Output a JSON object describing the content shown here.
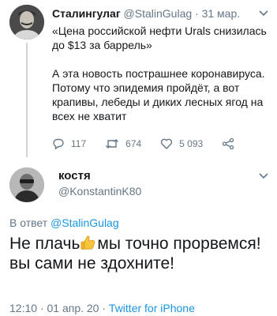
{
  "tweet1": {
    "author_name": "Сталингулаг",
    "author_handle": "@StalinGulag",
    "separator": "·",
    "date": "31 мар.",
    "paragraph1": "«Цена российской нефти Urals снизилась до $13 за баррель»",
    "paragraph2": "А эта новость пострашнее коронавируса. Потому что эпидемия пройдёт, а вот крапивы, лебеды и диких лесных ягод на всех не хватит",
    "replies": "117",
    "retweets": "674",
    "likes": "5 093",
    "icons": [
      "reply-icon",
      "retweet-icon",
      "like-icon",
      "share-icon",
      "chevron-down-icon"
    ]
  },
  "tweet2": {
    "author_name": "костя",
    "author_handle": "@KonstantinK80",
    "reply_prefix": "В ответ",
    "reply_mention": "@StalinGulag",
    "text_part1": "Не плачь",
    "text_part2": "мы точно прорвемся!",
    "text_part3": "вы сами не здохните!",
    "emoji": "thumbs-up-emoji",
    "time": "12:10",
    "separator": "·",
    "date": "01 апр. 20",
    "separator2": "·",
    "source": "Twitter for iPhone"
  },
  "colors": {
    "text": "#14171a",
    "secondary": "#657786",
    "link": "#1b95e0"
  }
}
